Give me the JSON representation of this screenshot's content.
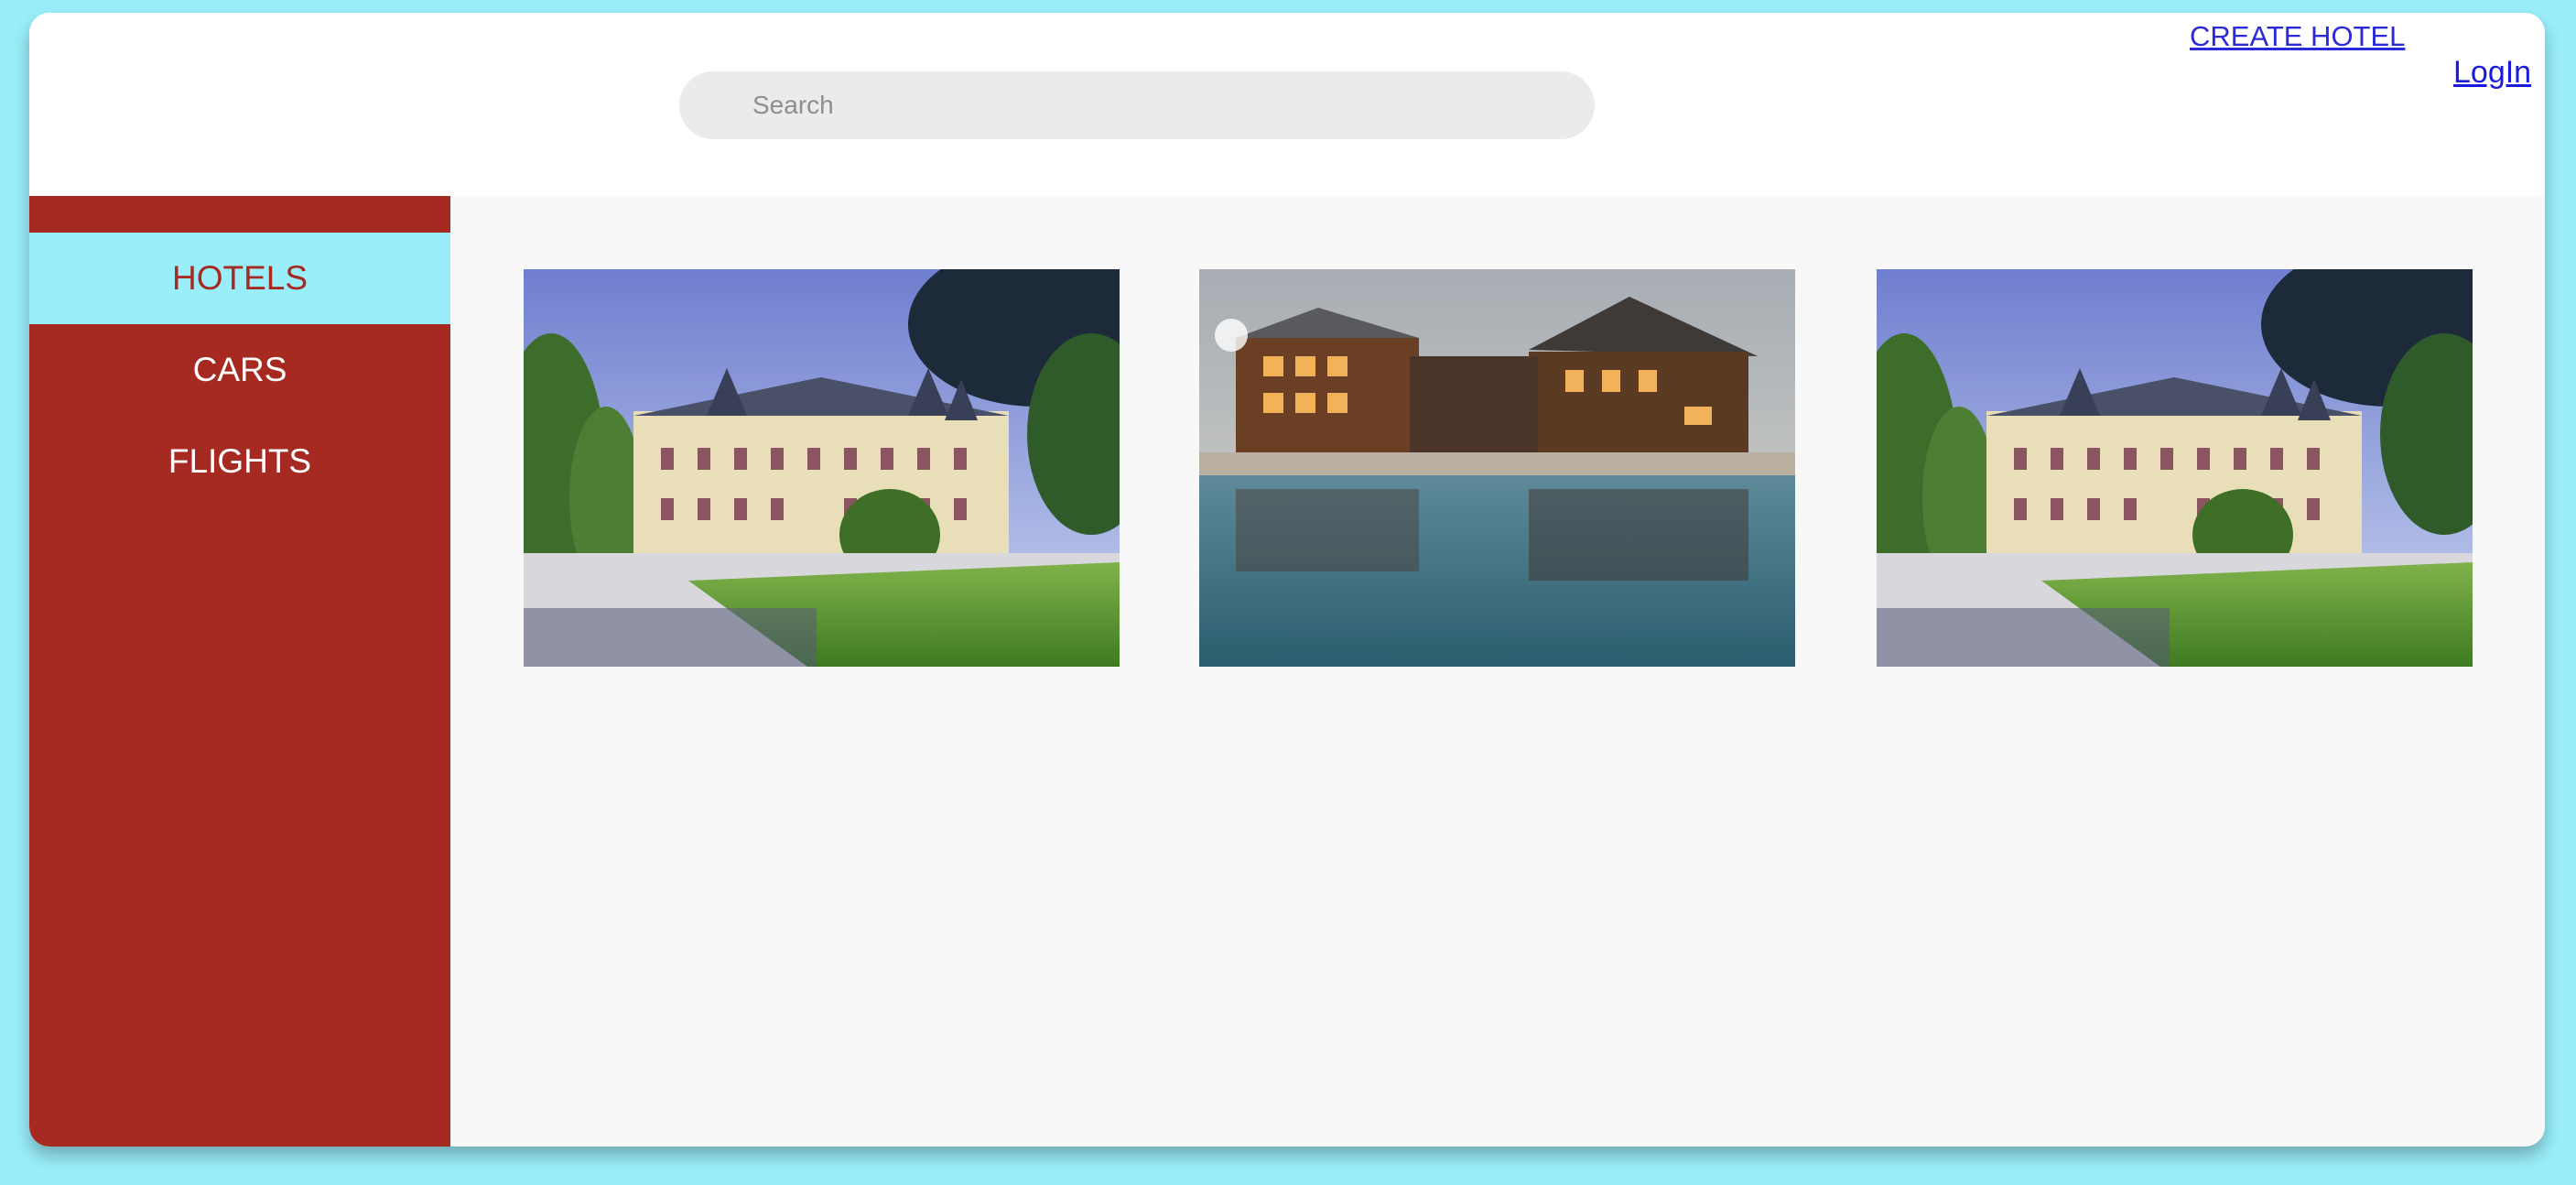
{
  "header": {
    "search_placeholder": "Search",
    "create_hotel_label": "CREATE HOTEL",
    "login_label": "LogIn"
  },
  "sidebar": {
    "items": [
      {
        "label": "HOTELS",
        "active": true
      },
      {
        "label": "CARS",
        "active": false
      },
      {
        "label": "FLIGHTS",
        "active": false
      }
    ]
  },
  "hotels": [
    {
      "image": "chateau-with-garden"
    },
    {
      "image": "lodge-with-pool"
    },
    {
      "image": "chateau-with-garden"
    }
  ],
  "colors": {
    "background": "#9aeefa",
    "sidebar": "#a72a22",
    "active_item": "#9aeefa",
    "main_bg": "#f8f8f8",
    "search_bg": "#ebebea",
    "link": "#1b1be0"
  }
}
